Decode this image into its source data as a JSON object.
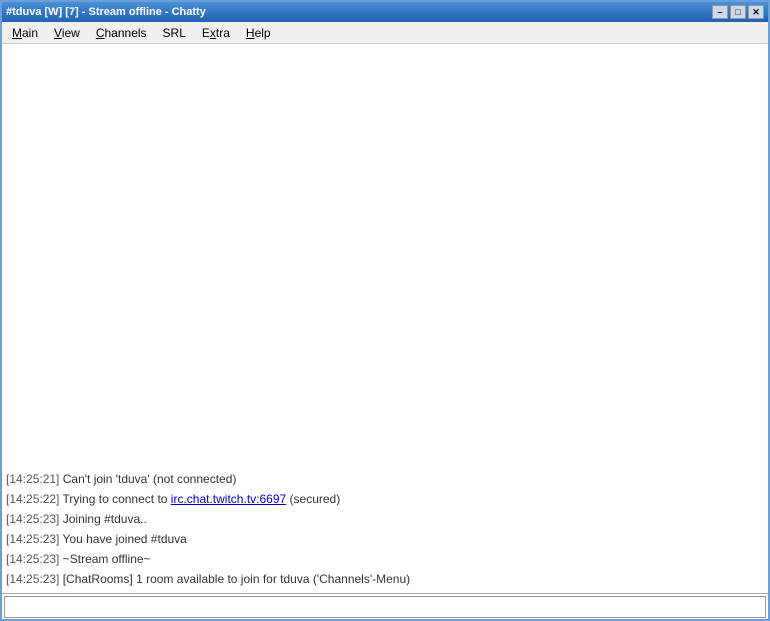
{
  "window": {
    "title": "#tduva [W] [7] - Stream offline - Chatty",
    "app_name": "Chatty"
  },
  "title_buttons": {
    "minimize": "–",
    "restore": "□",
    "close": "✕"
  },
  "menu": {
    "items": [
      {
        "id": "main",
        "label": "Main",
        "underline_index": 0
      },
      {
        "id": "view",
        "label": "View",
        "underline_index": 0
      },
      {
        "id": "channels",
        "label": "Channels",
        "underline_index": 0
      },
      {
        "id": "srl",
        "label": "SRL",
        "underline_index": 0
      },
      {
        "id": "extra",
        "label": "Extra",
        "underline_index": 0
      },
      {
        "id": "help",
        "label": "Help",
        "underline_index": 0
      }
    ]
  },
  "messages": [
    {
      "id": 1,
      "timestamp": "[14:25:21]",
      "text": " Can't join 'tduva' (not connected)",
      "has_link": false
    },
    {
      "id": 2,
      "timestamp": "[14:25:22]",
      "text_before": " Trying to connect to ",
      "link_text": "irc.chat.twitch.tv:6697",
      "text_after": " (secured)",
      "has_link": true
    },
    {
      "id": 3,
      "timestamp": "[14:25:23]",
      "text": " Joining #tduva..",
      "has_link": false
    },
    {
      "id": 4,
      "timestamp": "[14:25:23]",
      "text": " You have joined #tduva",
      "has_link": false
    },
    {
      "id": 5,
      "timestamp": "[14:25:23]",
      "text": " ~Stream offline~",
      "has_link": false,
      "is_stream_offline": true
    },
    {
      "id": 6,
      "timestamp": "[14:25:23]",
      "text": " [ChatRooms] 1 room available to join for tduva ('Channels'-Menu)",
      "has_link": false
    }
  ],
  "input": {
    "placeholder": "",
    "value": ""
  }
}
